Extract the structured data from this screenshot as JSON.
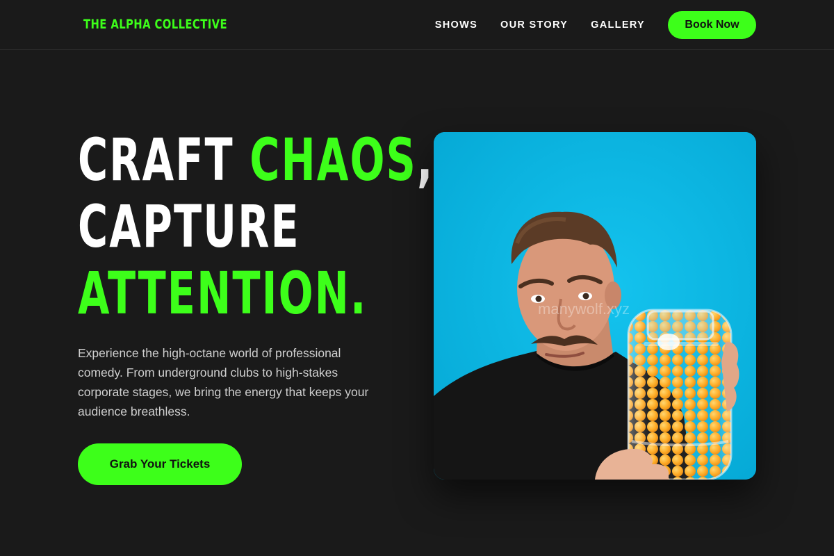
{
  "header": {
    "brand": "THE ALPHA COLLECTIVE",
    "nav": [
      {
        "label": "SHOWS"
      },
      {
        "label": "OUR STORY"
      },
      {
        "label": "GALLERY"
      }
    ],
    "cta_label": "Book Now"
  },
  "hero": {
    "headline": {
      "line1_white": "CRAFT ",
      "line1_green": "CHAOS",
      "line1_tail": ",",
      "line2": "CAPTURE",
      "line3": "ATTENTION."
    },
    "lede": "Experience the high-octane world of professional comedy. From underground clubs to high-stakes corporate stages, we bring the energy that keeps your audience breathless.",
    "cta_label": "Grab Your Tickets",
    "image_watermark": "manywolf.xyz"
  },
  "colors": {
    "background": "#1a1a1a",
    "accent": "#3dff1a",
    "image_bg": "#08b6e2"
  }
}
